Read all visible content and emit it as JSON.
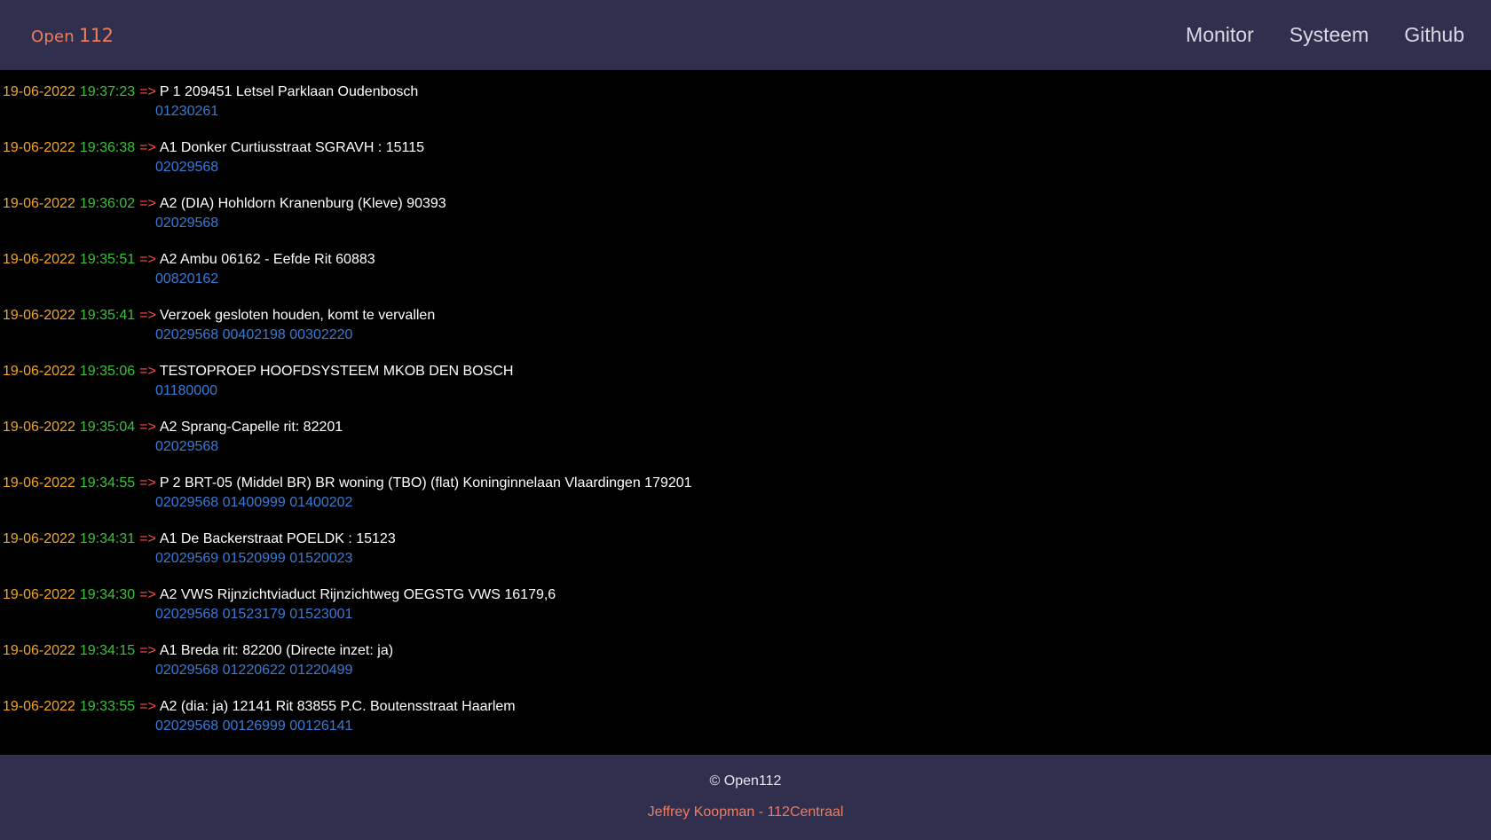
{
  "header": {
    "brand_word": "Open",
    "brand_num": "112",
    "nav": [
      {
        "label": "Monitor"
      },
      {
        "label": "Systeem"
      },
      {
        "label": "Github"
      }
    ]
  },
  "entries": [
    {
      "date": "19-06-2022",
      "time": "19:37:23",
      "arrow": "=>",
      "message": "P 1 209451 Letsel Parklaan Oudenbosch",
      "codes": "01230261"
    },
    {
      "date": "19-06-2022",
      "time": "19:36:38",
      "arrow": "=>",
      "message": "A1 Donker Curtiusstraat SGRAVH : 15115",
      "codes": "02029568"
    },
    {
      "date": "19-06-2022",
      "time": "19:36:02",
      "arrow": "=>",
      "message": "A2 (DIA) Hohldorn Kranenburg (Kleve) 90393",
      "codes": "02029568"
    },
    {
      "date": "19-06-2022",
      "time": "19:35:51",
      "arrow": "=>",
      "message": "A2 Ambu 06162 - Eefde Rit 60883",
      "codes": "00820162"
    },
    {
      "date": "19-06-2022",
      "time": "19:35:41",
      "arrow": "=>",
      "message": "Verzoek gesloten houden, komt te vervallen",
      "codes": "02029568 00402198 00302220"
    },
    {
      "date": "19-06-2022",
      "time": "19:35:06",
      "arrow": "=>",
      "message": "TESTOPROEP HOOFDSYSTEEM MKOB DEN BOSCH",
      "codes": "01180000"
    },
    {
      "date": "19-06-2022",
      "time": "19:35:04",
      "arrow": "=>",
      "message": "A2 Sprang-Capelle rit: 82201",
      "codes": "02029568"
    },
    {
      "date": "19-06-2022",
      "time": "19:34:55",
      "arrow": "=>",
      "message": "P 2 BRT-05 (Middel BR) BR woning (TBO) (flat) Koninginnelaan Vlaardingen 179201",
      "codes": "02029568 01400999 01400202"
    },
    {
      "date": "19-06-2022",
      "time": "19:34:31",
      "arrow": "=>",
      "message": "A1 De Backerstraat POELDK : 15123",
      "codes": "02029569 01520999 01520023"
    },
    {
      "date": "19-06-2022",
      "time": "19:34:30",
      "arrow": "=>",
      "message": "A2 VWS Rijnzichtviaduct Rijnzichtweg OEGSTG VWS 16179,6",
      "codes": "02029568 01523179 01523001"
    },
    {
      "date": "19-06-2022",
      "time": "19:34:15",
      "arrow": "=>",
      "message": "A1 Breda rit: 82200 (Directe inzet: ja)",
      "codes": "02029568 01220622 01220499"
    },
    {
      "date": "19-06-2022",
      "time": "19:33:55",
      "arrow": "=>",
      "message": "A2 (dia: ja) 12141 Rit 83855 P.C. Boutensstraat Haarlem",
      "codes": "02029568 00126999 00126141"
    }
  ],
  "footer": {
    "copyright": "© Open112",
    "author": "Jeffrey Koopman - 112Centraal"
  },
  "colors": {
    "navbar_bg": "#302f4d",
    "brand": "#f07c5e",
    "date": "#f5a623",
    "time": "#3cc13b",
    "arrow": "#ff4d4d",
    "codes": "#3a7bd5"
  }
}
